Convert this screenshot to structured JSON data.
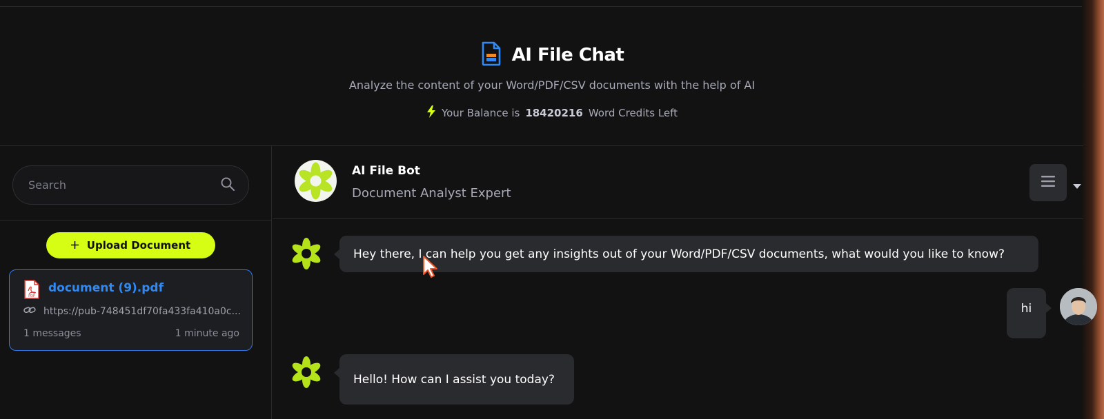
{
  "hero": {
    "title": "AI File Chat",
    "subtitle": "Analyze the content of your Word/PDF/CSV documents with the help of AI",
    "balance_prefix": "Your Balance is",
    "balance_value": "18420216",
    "balance_suffix": "Word Credits Left",
    "icon": "file-document-icon",
    "balance_icon": "lightning-icon"
  },
  "sidebar": {
    "search": {
      "placeholder": "Search",
      "value": ""
    },
    "upload_label": "Upload Document",
    "documents": [
      {
        "name": "document (9).pdf",
        "link": "https://pub-748451df70fa433fa410a0c...",
        "messages": "1 messages",
        "time": "1 minute ago"
      }
    ]
  },
  "chat": {
    "bot_name": "AI File Bot",
    "bot_role": "Document Analyst Expert",
    "messages": [
      {
        "from": "bot",
        "text": "Hey there, I can help you get any insights out of your Word/PDF/CSV documents, what would you like to know?"
      },
      {
        "from": "user",
        "text": "hi"
      },
      {
        "from": "bot",
        "text": "Hello! How can I assist you today?"
      }
    ]
  },
  "colors": {
    "background": "#121213",
    "accent": "#d6fe15",
    "link_blue": "#2f8af5",
    "bubble": "#2a2b2e"
  }
}
